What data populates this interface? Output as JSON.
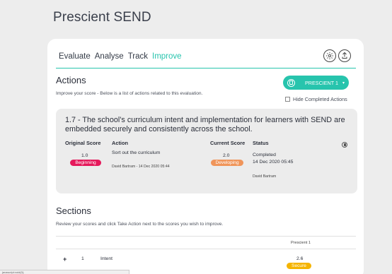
{
  "app": {
    "title": "Prescient SEND"
  },
  "tabs": [
    {
      "label": "Evaluate"
    },
    {
      "label": "Analyse"
    },
    {
      "label": "Track"
    },
    {
      "label": "Improve"
    }
  ],
  "actions": {
    "title": "Actions",
    "subtitle": "Improve your score - Below is a list of actions related to this evaluation.",
    "dropdown_label": "PRESCIENT 1",
    "hide_completed_label": "Hide Completed Actions"
  },
  "action_item": {
    "title": "1.7 - The school’s curriculum intent and implementation for learners with SEND are embedded securely and consistently across the school.",
    "headers": {
      "original_score": "Original Score",
      "action": "Action",
      "current_score": "Current Score",
      "status": "Status"
    },
    "original_score": "1.0",
    "original_badge": "Beginning",
    "action_text": "Sort out the curriculum",
    "action_meta": "David Bartram - 14 Dec 2020 05:44",
    "current_score": "2.0",
    "current_badge": "Developing",
    "status": "Completed",
    "status_date": "14 Dec 2020 05:45",
    "status_by": "David Bartram"
  },
  "sections": {
    "title": "Sections",
    "subtitle": "Review your scores and click Take Action next to the scores you wish to improve.",
    "column_label": "Prescient 1",
    "rows": [
      {
        "expand": "+",
        "number": "1",
        "name": "Intent",
        "score": "2.6",
        "badge": "Secure"
      }
    ]
  },
  "statusbar": {
    "text": "javascript:void(0);"
  },
  "colors": {
    "accent": "#27c4ad",
    "beginning": "#e5195b",
    "developing": "#f0955a",
    "secure": "#f5b400"
  }
}
